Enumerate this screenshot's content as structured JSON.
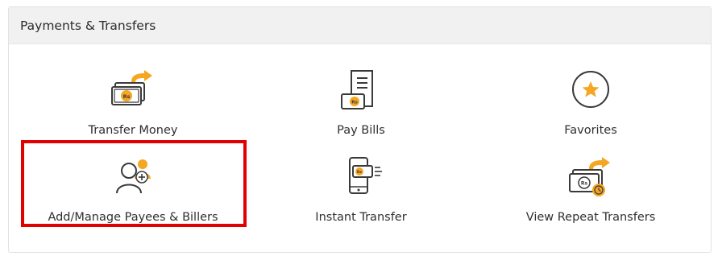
{
  "panel": {
    "title": "Payments & Transfers"
  },
  "tiles": [
    {
      "label": "Transfer Money",
      "icon": "transfer-money-icon"
    },
    {
      "label": "Pay Bills",
      "icon": "pay-bills-icon"
    },
    {
      "label": "Favorites",
      "icon": "favorites-star-icon"
    },
    {
      "label": "Add/Manage Payees & Billers",
      "icon": "add-payee-icon",
      "highlighted": true
    },
    {
      "label": "Instant Transfer",
      "icon": "instant-transfer-icon"
    },
    {
      "label": "View Repeat Transfers",
      "icon": "repeat-transfer-icon"
    }
  ],
  "icon_currency_text": "Rs",
  "colors": {
    "accent": "#f5a623",
    "icon_stroke": "#3a3a3a",
    "highlight_border": "#e30000",
    "header_bg": "#f1f1f1"
  }
}
